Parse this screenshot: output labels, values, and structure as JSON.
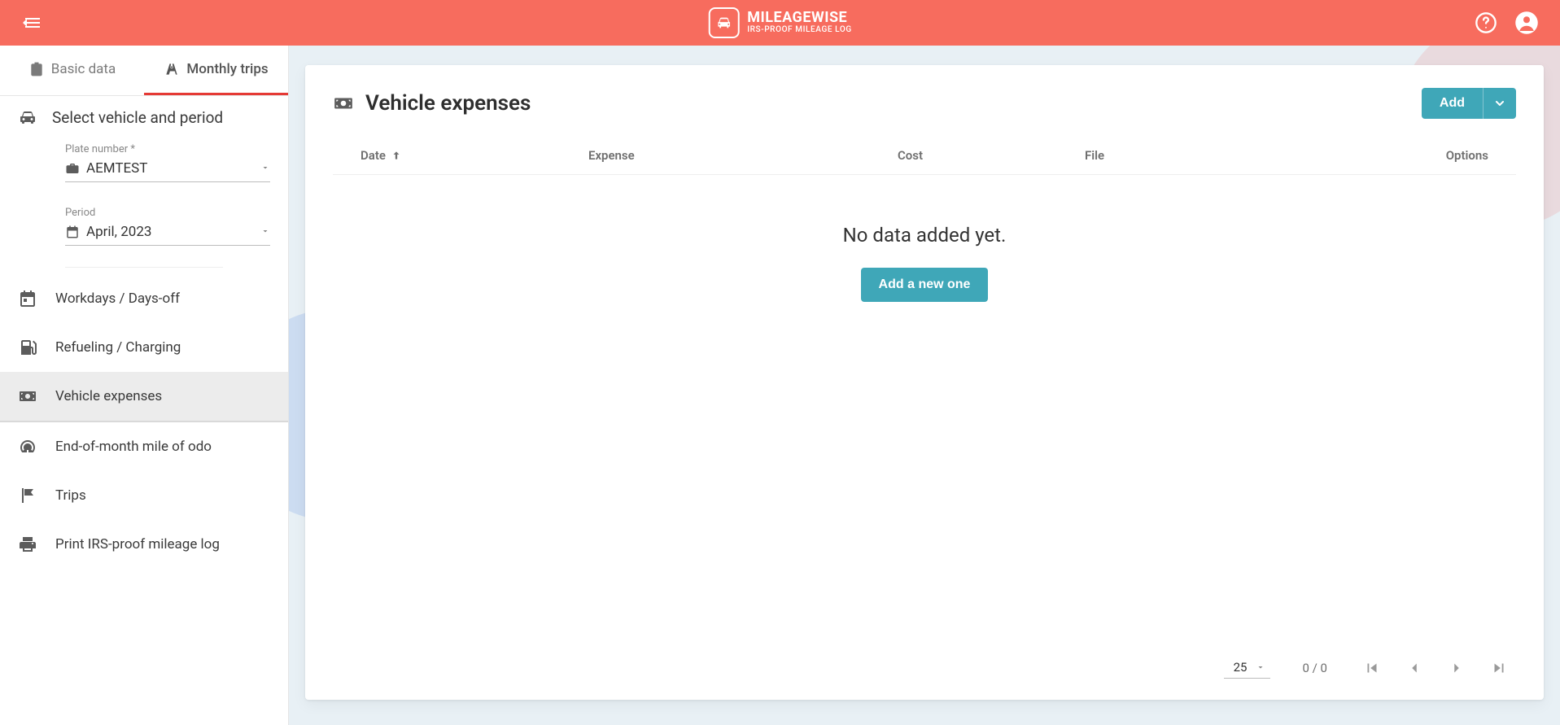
{
  "brand": {
    "title": "MILEAGEWISE",
    "subtitle": "IRS-PROOF MILEAGE LOG"
  },
  "tabs": {
    "basic": "Basic data",
    "monthly": "Monthly trips"
  },
  "sidebar": {
    "select_header": "Select vehicle and period",
    "plate_label": "Plate number *",
    "plate_value": "AEMTEST",
    "period_label": "Period",
    "period_value": "April, 2023",
    "nav": {
      "workdays": "Workdays / Days-off",
      "refueling": "Refueling / Charging",
      "vehicle_expenses": "Vehicle expenses",
      "odo": "End-of-month mile of odo",
      "trips": "Trips",
      "print": "Print IRS-proof mileage log"
    }
  },
  "main": {
    "title": "Vehicle expenses",
    "add_button": "Add",
    "columns": {
      "date": "Date",
      "expense": "Expense",
      "cost": "Cost",
      "file": "File",
      "options": "Options"
    },
    "empty_message": "No data added yet.",
    "add_new_button": "Add a new one",
    "pager": {
      "page_size": "25",
      "range": "0 / 0"
    }
  }
}
